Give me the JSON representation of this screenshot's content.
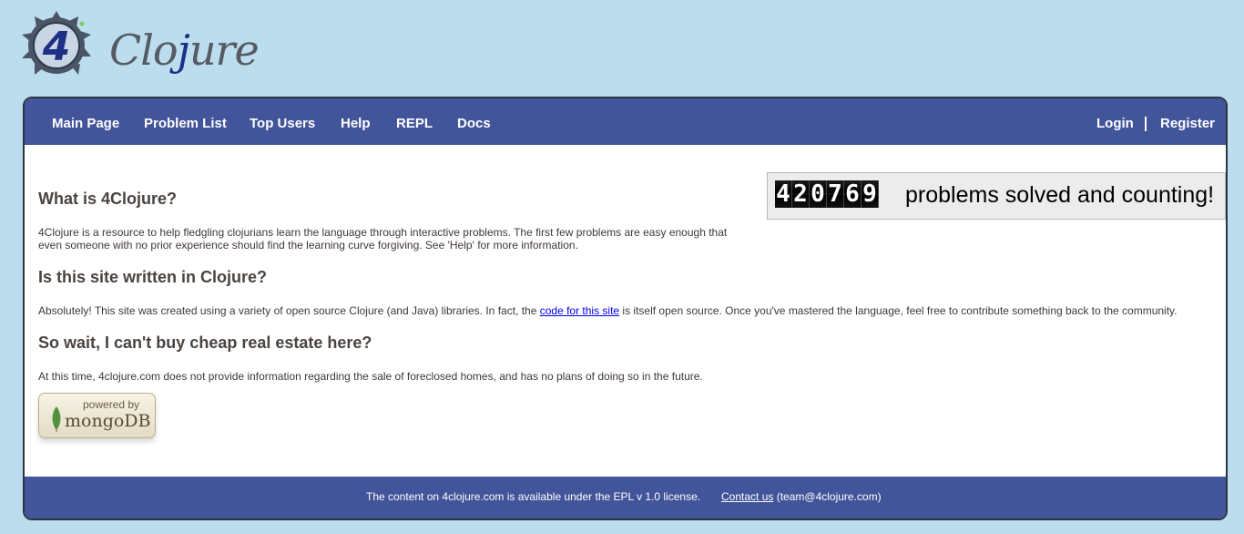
{
  "logo": {
    "prefix": "4",
    "text_c": "Clo",
    "text_j": "j",
    "text_rest": "ure"
  },
  "nav": {
    "main_page": "Main Page",
    "problem_list": "Problem List",
    "top_users": "Top Users",
    "help": "Help",
    "repl": "REPL",
    "docs": "Docs",
    "login": "Login",
    "register": "Register"
  },
  "counter": {
    "digits": [
      "4",
      "2",
      "0",
      "7",
      "6",
      "9"
    ],
    "text": "problems solved and counting!"
  },
  "sections": [
    {
      "heading": "What is 4Clojure?",
      "body": "4Clojure is a resource to help fledgling clojurians learn the language through interactive problems. The first few problems are easy enough that even someone with no prior experience should find the learning curve forgiving. See 'Help' for more information."
    },
    {
      "heading": "Is this site written in Clojure?",
      "body_before": "Absolutely! This site was created using a variety of open source Clojure (and Java) libraries. In fact, the ",
      "link": "code for this site",
      "body_after": " is itself open source. Once you've mastered the language, feel free to contribute something back to the community."
    },
    {
      "heading": "So wait, I can't buy cheap real estate here?",
      "body": "At this time, 4clojure.com does not provide information regarding the sale of foreclosed homes, and has no plans of doing so in the future."
    }
  ],
  "mongo_badge": {
    "powered_by": "powered by",
    "brand": "mongoDB"
  },
  "footer": {
    "license": "The content on 4clojure.com is available under the EPL v 1.0 license.",
    "contact_link": "Contact us",
    "contact_email": " (team@4clojure.com)"
  },
  "colors": {
    "page_bg": "#bcddee",
    "nav_bg": "#42549a",
    "heading": "#4a4340",
    "link": "#0000ee"
  }
}
